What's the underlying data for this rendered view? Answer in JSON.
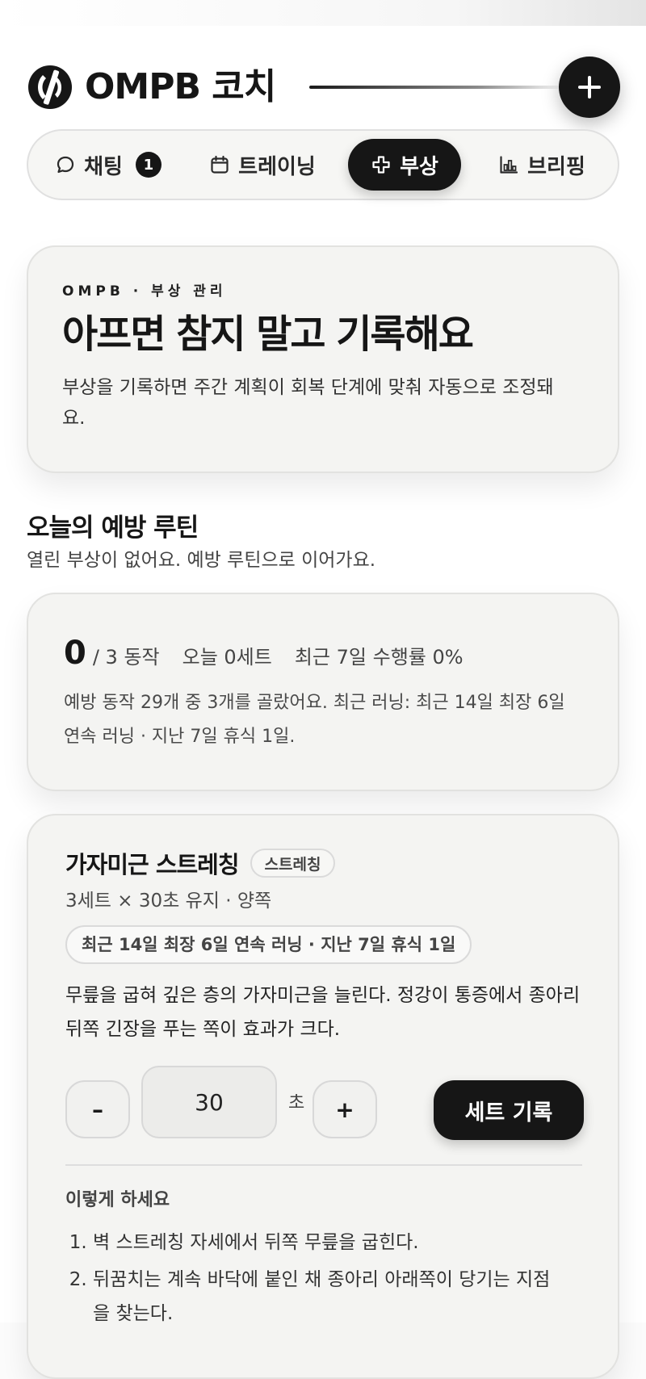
{
  "header": {
    "brand": "OMPB 코치"
  },
  "tabs": [
    {
      "label": "채팅",
      "badge": "1",
      "icon": "chat-bubble-icon"
    },
    {
      "label": "트레이닝",
      "icon": "calendar-icon"
    },
    {
      "label": "부상",
      "icon": "medical-cross-icon",
      "active": true
    },
    {
      "label": "브리핑",
      "icon": "bar-chart-icon"
    }
  ],
  "hero": {
    "eyebrow": "OMPB · 부상 관리",
    "title": "아프면 참지 말고 기록해요",
    "desc": "부상을 기록하면 주간 계획이 회복 단계에 맞춰 자동으로 조정돼요."
  },
  "routine": {
    "title": "오늘의 예방 루틴",
    "subtitle": "열린 부상이 없어요. 예방 루틴으로 이어가요.",
    "done": "0",
    "total_text": "/ 3 동작",
    "today_sets": "오늘 0세트",
    "rate": "최근 7일 수행률 0%",
    "desc": "예방 동작 29개 중 3개를 골랐어요. 최근 러닝: 최근 14일 최장 6일 연속 러닝 · 지난 7일 휴식 1일."
  },
  "exercise": {
    "title": "가자미근 스트레칭",
    "tag": "스트레칭",
    "dose": "3세트 × 30초 유지 · 양쪽",
    "chip": "최근 14일 최장 6일 연속 러닝 · 지난 7일 휴식 1일",
    "desc": "무릎을 굽혀 깊은 층의 가자미근을 늘린다. 정강이 통증에서 종아리 뒤쪽 긴장을 푸는 쪽이 효과가 크다.",
    "minus": "–",
    "value": "30",
    "unit": "초",
    "plus": "+",
    "record": "세트 기록",
    "howto_title": "이렇게 하세요",
    "steps": [
      "벽 스트레칭 자세에서 뒤쪽 무릎을 굽힌다.",
      "뒤꿈치는 계속 바닥에 붙인 채 종아리 아래쪽이 당기는 지점을 찾는다."
    ]
  },
  "colors": {
    "accent": "#161616",
    "card": "#f4f4f2",
    "border": "#e2e2e0"
  }
}
